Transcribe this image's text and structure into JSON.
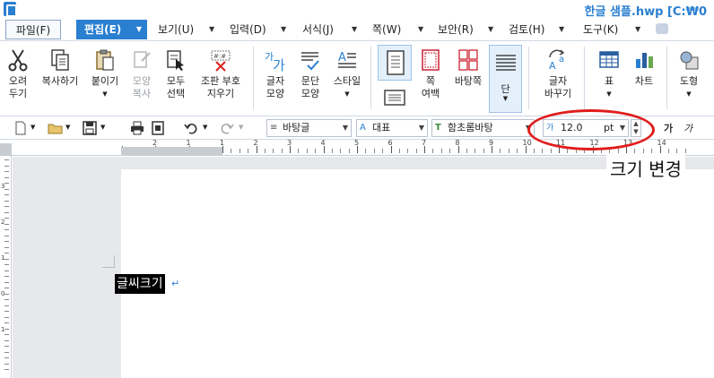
{
  "title": "한글 샘플.hwp [C:₩0",
  "menu": {
    "file": "파일(F)",
    "edit": "편집(E)",
    "view": "보기(U)",
    "input": "입력(D)",
    "format": "서식(J)",
    "page": "쪽(W)",
    "security": "보안(R)",
    "review": "검토(H)",
    "tools": "도구(K)"
  },
  "ribbon": {
    "cut": [
      "오려",
      "두기"
    ],
    "copy": "복사하기",
    "paste": "붙이기",
    "format_copy": [
      "모양",
      "복사"
    ],
    "select_all": [
      "모두",
      "선택"
    ],
    "erase_codes": [
      "조판 부호",
      "지우기"
    ],
    "char_shape": [
      "글자",
      "모양"
    ],
    "para_shape": [
      "문단",
      "모양"
    ],
    "style": "스타일",
    "page_margin": [
      "쪽",
      "여백"
    ],
    "background": "바탕쪽",
    "column": "단",
    "change_char": [
      "글자",
      "바꾸기"
    ],
    "table": "표",
    "chart": "차트",
    "shape": "도형"
  },
  "format_bar": {
    "style": "바탕글",
    "language": "대표",
    "font": "함초롬바탕",
    "font_size": "12.0",
    "size_unit": "pt",
    "bold_glyph": "가",
    "italic_glyph": "가"
  },
  "ruler": {
    "h_labels": [
      "2",
      "1",
      "1",
      "2",
      "3",
      "4",
      "5",
      "6",
      "7",
      "8",
      "9",
      "10",
      "11",
      "12",
      "13",
      "14"
    ],
    "v_labels": [
      "3",
      "2",
      "1",
      "0",
      "1"
    ]
  },
  "document": {
    "selected_text": "글씨크기",
    "paragraph_mark": "↵"
  },
  "annotation": {
    "label": "크기 변경",
    "color": "#e01d1d"
  },
  "colors": {
    "accent": "#2a7fd1"
  }
}
